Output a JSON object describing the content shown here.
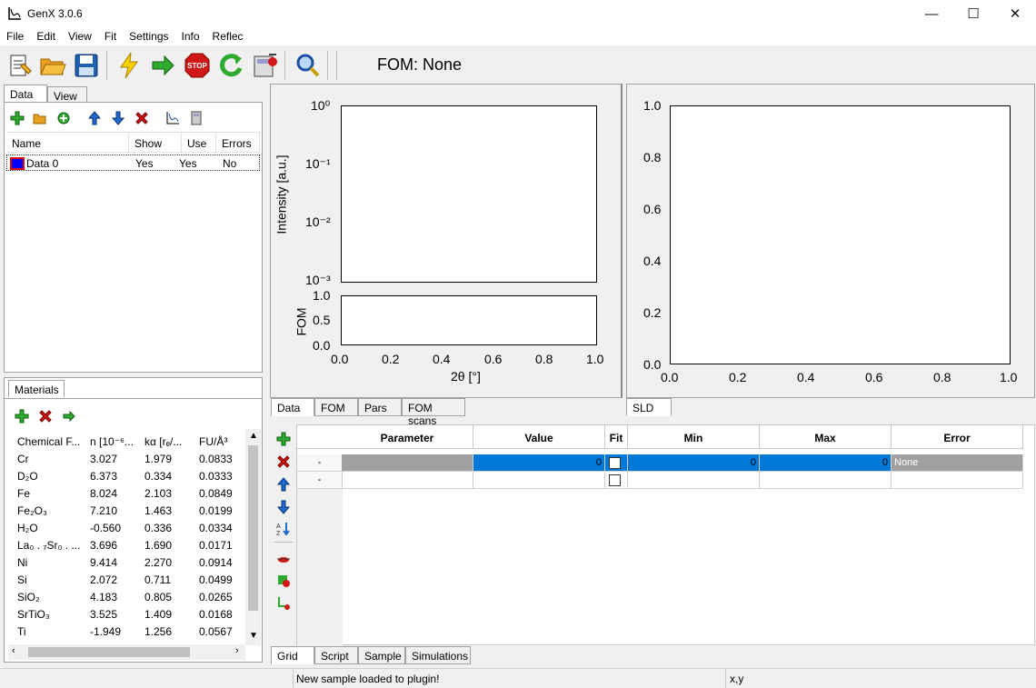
{
  "window": {
    "title": "GenX 3.0.6",
    "minimize": "—",
    "maximize": "☐",
    "close": "✕"
  },
  "menu": [
    "File",
    "Edit",
    "View",
    "Fit",
    "Settings",
    "Info",
    "Reflec"
  ],
  "toolbar": {
    "fom_label": "FOM: None"
  },
  "left_tabs": {
    "data": "Data",
    "view": "View"
  },
  "data_list": {
    "columns": [
      "Name",
      "Show",
      "Use",
      "Errors"
    ],
    "rows": [
      {
        "name": "Data 0",
        "show": "Yes",
        "use": "Yes",
        "errors": "No"
      }
    ]
  },
  "materials": {
    "tab": "Materials",
    "columns": [
      "Chemical F...",
      "n [10⁻⁶...",
      "kα [rₑ/...",
      "FU/Å³"
    ],
    "rows": [
      [
        "Cr",
        "3.027",
        "1.979",
        "0.0833"
      ],
      [
        "D₂O",
        "6.373",
        "0.334",
        "0.0333"
      ],
      [
        "Fe",
        "8.024",
        "2.103",
        "0.0849"
      ],
      [
        "Fe₂O₃",
        "7.210",
        "1.463",
        "0.0199"
      ],
      [
        "H₂O",
        "-0.560",
        "0.336",
        "0.0334"
      ],
      [
        "La₀ . ₇Sr₀ . ...",
        "3.696",
        "1.690",
        "0.0171"
      ],
      [
        "Ni",
        "9.414",
        "2.270",
        "0.0914"
      ],
      [
        "Si",
        "2.072",
        "0.711",
        "0.0499"
      ],
      [
        "SiO₂",
        "4.183",
        "0.805",
        "0.0265"
      ],
      [
        "SrTiO₃",
        "3.525",
        "1.409",
        "0.0168"
      ],
      [
        "Ti",
        "-1.949",
        "1.256",
        "0.0567"
      ]
    ]
  },
  "plot_left": {
    "ylabel": "Intensity [a.u.]",
    "y_ticks": [
      "10⁰",
      "10⁻¹",
      "10⁻²",
      "10⁻³"
    ],
    "fom_ylabel": "FOM",
    "fom_y_ticks": [
      "1.0",
      "0.5",
      "0.0"
    ],
    "x_ticks": [
      "0.0",
      "0.2",
      "0.4",
      "0.6",
      "0.8",
      "1.0"
    ],
    "xlabel": "2θ [°]"
  },
  "plot_right": {
    "y_ticks": [
      "1.0",
      "0.8",
      "0.6",
      "0.4",
      "0.2",
      "0.0"
    ],
    "x_ticks": [
      "0.0",
      "0.2",
      "0.4",
      "0.6",
      "0.8",
      "1.0"
    ]
  },
  "plot_tabs": {
    "data": "Data",
    "fom": "FOM",
    "pars": "Pars",
    "fom_scans": "FOM scans",
    "sld": "SLD"
  },
  "grid": {
    "columns": [
      "Parameter",
      "Value",
      "Fit",
      "Min",
      "Max",
      "Error"
    ],
    "rows": [
      {
        "label": "-",
        "parameter": "",
        "value": "0",
        "min": "0",
        "max": "0",
        "error": "None"
      },
      {
        "label": "-",
        "parameter": "",
        "value": "",
        "min": "",
        "max": "",
        "error": ""
      }
    ]
  },
  "bottom_tabs": {
    "grid": "Grid",
    "script": "Script",
    "sample": "Sample",
    "simulations": "Simulations"
  },
  "status": {
    "message": "New sample loaded to plugin!",
    "coords": "x,y"
  },
  "colors": {
    "selection": "#0078d7",
    "param_cell": "#a0a0a0"
  }
}
